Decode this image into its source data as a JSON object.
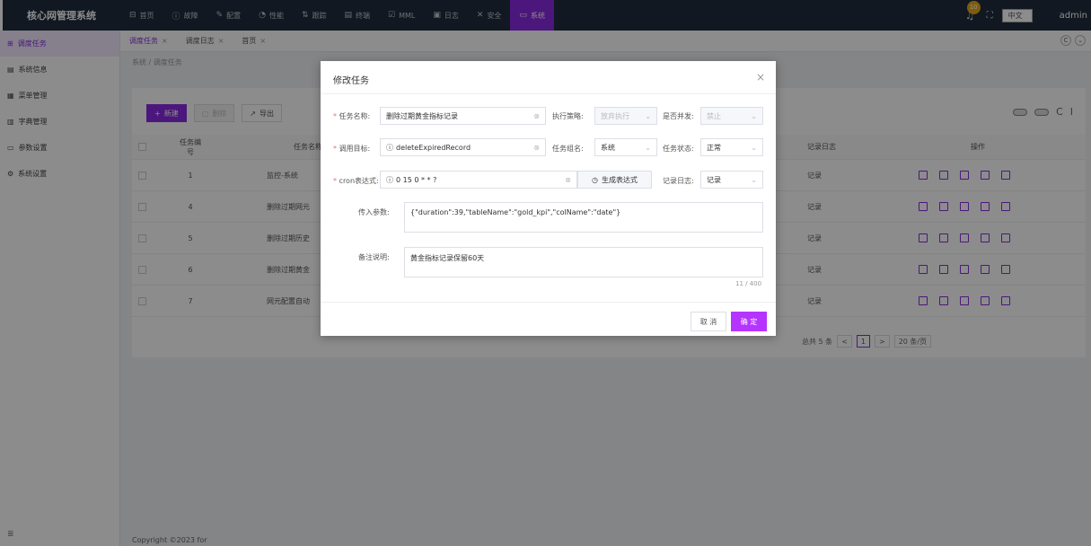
{
  "app": {
    "title": "核心网管理系统"
  },
  "topnav": [
    {
      "icon": "⊟",
      "label": "首页"
    },
    {
      "icon": "ⓘ",
      "label": "故障"
    },
    {
      "icon": "✎",
      "label": "配置"
    },
    {
      "icon": "◔",
      "label": "性能"
    },
    {
      "icon": "⇅",
      "label": "跟踪"
    },
    {
      "icon": "▤",
      "label": "终端"
    },
    {
      "icon": "☑",
      "label": "MML"
    },
    {
      "icon": "▣",
      "label": "日志"
    },
    {
      "icon": "✕",
      "label": "安全"
    },
    {
      "icon": "▭",
      "label": "系统"
    }
  ],
  "header": {
    "notification_count": "10",
    "language": "中文",
    "user": "admin"
  },
  "sidebar": [
    {
      "icon": "⊞",
      "label": "调度任务"
    },
    {
      "icon": "▤",
      "label": "系统信息"
    },
    {
      "icon": "▦",
      "label": "菜单管理"
    },
    {
      "icon": "▥",
      "label": "字典管理"
    },
    {
      "icon": "▭",
      "label": "参数设置"
    },
    {
      "icon": "⚙",
      "label": "系统设置"
    }
  ],
  "sidebar_bottom_icon": "≣",
  "tabs": [
    {
      "label": "调度任务"
    },
    {
      "label": "调度日志"
    },
    {
      "label": "首页"
    }
  ],
  "breadcrumb": "系统 / 调度任务",
  "toolbar": {
    "add": "新建",
    "delete": "删除",
    "export": "导出"
  },
  "table": {
    "headers": {
      "id": "任务编号",
      "name": "任务名称",
      "log": "记录日志",
      "ops": "操作"
    },
    "rows": [
      {
        "id": "1",
        "name": "监控-系统",
        "log": "记录"
      },
      {
        "id": "4",
        "name": "删除过期网元",
        "log": "记录"
      },
      {
        "id": "5",
        "name": "删除过期历史",
        "log": "记录"
      },
      {
        "id": "6",
        "name": "删除过期黄金",
        "log": "记录"
      },
      {
        "id": "7",
        "name": "网元配置自动",
        "log": "记录"
      }
    ]
  },
  "pagination": {
    "total": "总共 5 条",
    "current": "1",
    "page_size": "20 条/页"
  },
  "footer": "Copyright ©2023 for",
  "dialog": {
    "title": "修改任务",
    "task_name_label": "任务名称:",
    "task_name": "删除过期黄金指标记录",
    "strategy_label": "执行策略:",
    "strategy": "放弃执行",
    "concurrent_label": "是否并发:",
    "concurrent": "禁止",
    "target_label": "调用目标:",
    "target": "deleteExpiredRecord",
    "group_label": "任务组名:",
    "group": "系统",
    "status_label": "任务状态:",
    "status": "正常",
    "cron_label": "cron表达式:",
    "cron": "0 15 0 * * ?",
    "gen_cron": "生成表达式",
    "log_label": "记录日志:",
    "log": "记录",
    "params_label": "传入参数:",
    "params": "{\"duration\":39,\"tableName\":\"gold_kpi\",\"colName\":\"date\"}",
    "remark_label": "备注说明:",
    "remark": "黄金指标记录保留60天",
    "remark_count": "11 / 400",
    "cancel": "取 消",
    "ok": "确 定"
  },
  "colors": {
    "accent": "#8a2be2",
    "topbar": "#1f2d3d"
  }
}
